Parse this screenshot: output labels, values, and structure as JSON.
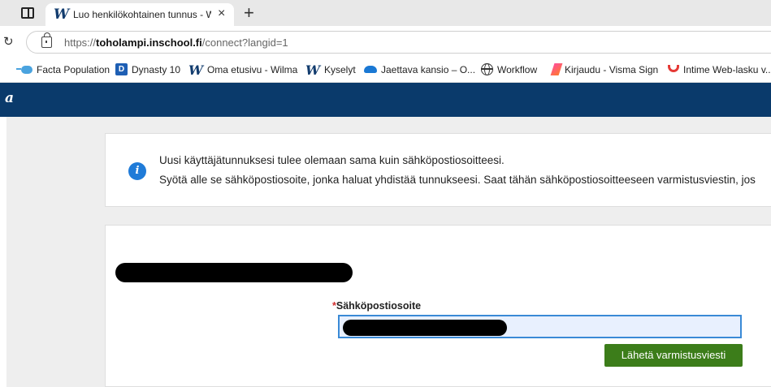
{
  "browser": {
    "tab_title": "Luo henkilökohtainen tunnus - Wilma",
    "tab_close": "×",
    "new_tab": "+",
    "url_scheme": "https://",
    "url_host": "toholampi.inschool.fi",
    "url_path": "/connect?langid=1"
  },
  "bookmarks": [
    {
      "label": "Facta Population",
      "icon": "facta-icon"
    },
    {
      "label": "Dynasty 10",
      "icon": "dynasty-icon",
      "icon_text": "D"
    },
    {
      "label": "Oma etusivu - Wilma",
      "icon": "wilma-icon"
    },
    {
      "label": "Kyselyt",
      "icon": "wilma-icon"
    },
    {
      "label": "Jaettava kansio – O...",
      "icon": "onedrive-icon"
    },
    {
      "label": "Workflow",
      "icon": "globe-icon"
    },
    {
      "label": "Kirjaudu - Visma Sign",
      "icon": "visma-icon"
    },
    {
      "label": "Intime Web-lasku v...",
      "icon": "intime-icon"
    }
  ],
  "app": {
    "logo_fragment": "a"
  },
  "info": {
    "icon_glyph": "i",
    "line1": "Uusi käyttäjätunnuksesi tulee olemaan sama kuin sähköpostiosoitteesi.",
    "line2": "Syötä alle se sähköpostiosoite, jonka haluat yhdistää tunnukseesi. Saat tähän sähköpostiosoitteeseen varmistusviestin, jos"
  },
  "form": {
    "required_mark": "*",
    "email_label": "Sähköpostiosoite",
    "submit_label": "Lähetä varmistusviesti"
  },
  "colors": {
    "header": "#0a3a6b",
    "submit": "#3c7d1a",
    "info_icon": "#1f7bd8",
    "input_border": "#3a8ad6",
    "required": "#d12e2e"
  }
}
